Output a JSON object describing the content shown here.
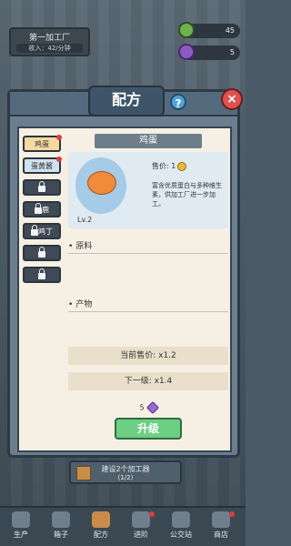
{
  "header": {
    "title": "第一加工厂",
    "subtitle": "收入：42/分钟",
    "resource1": "45",
    "resource2": "5"
  },
  "dialog": {
    "title": "配方",
    "help": "?",
    "close": "×"
  },
  "tabs": [
    {
      "label": "鸡蛋",
      "state": "active"
    },
    {
      "label": "蛋黄酱",
      "state": "unlocked"
    },
    {
      "label": "",
      "state": "locked"
    },
    {
      "label": "鹿",
      "state": "locked"
    },
    {
      "label": "鸡丁",
      "state": "locked"
    },
    {
      "label": "",
      "state": "locked"
    },
    {
      "label": "",
      "state": "locked"
    }
  ],
  "item": {
    "name": "鸡蛋",
    "level": "Lv.2",
    "price_label": "售价: 1",
    "description": "富含优质蛋白与多种维生素，供加工厂进一步加工。"
  },
  "sections": {
    "ingredients": "原料",
    "products": "产物"
  },
  "stats": {
    "current_price": "当前售价: x1.2",
    "next_level": "下一级: x1.4"
  },
  "upgrade": {
    "cost": "5",
    "label": "升级"
  },
  "build": {
    "line1": "建设2个加工器",
    "line2": "(1/2)"
  },
  "nav": [
    "生产",
    "箱子",
    "配方",
    "进阶",
    "公交站",
    "商店"
  ]
}
